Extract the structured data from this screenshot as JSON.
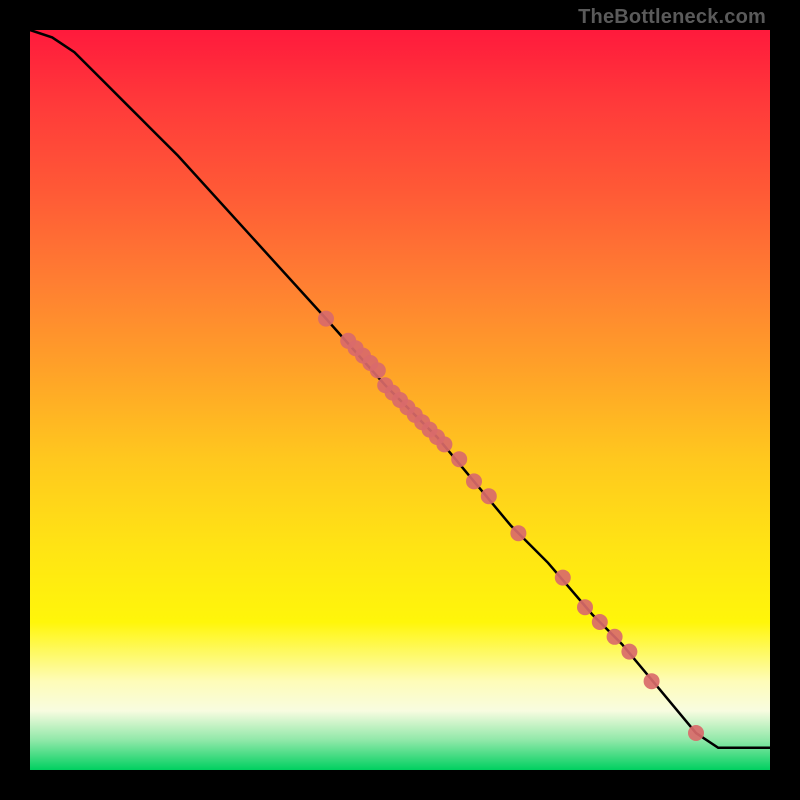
{
  "watermark": "TheBottleneck.com",
  "chart_data": {
    "type": "line",
    "title": "",
    "xlabel": "",
    "ylabel": "",
    "xlim": [
      0,
      100
    ],
    "ylim": [
      0,
      100
    ],
    "note": "No visible axis ticks or numeric labels in source image; values are approximate fractions of plot area read from pixel positions.",
    "series": [
      {
        "name": "curve",
        "x": [
          0,
          3,
          6,
          10,
          15,
          20,
          30,
          40,
          48,
          50,
          55,
          60,
          65,
          70,
          76,
          80,
          85,
          90,
          93,
          95,
          100
        ],
        "y": [
          100,
          99,
          97,
          93,
          88,
          83,
          72,
          61,
          52,
          50,
          45,
          39,
          33,
          28,
          21,
          17,
          11,
          5,
          3,
          3,
          3
        ]
      }
    ],
    "points": {
      "name": "markers",
      "x": [
        40,
        43,
        44,
        45,
        46,
        47,
        48,
        49,
        50,
        51,
        52,
        53,
        54,
        55,
        56,
        58,
        60,
        62,
        66,
        72,
        75,
        77,
        79,
        81,
        84,
        90
      ],
      "y": [
        61,
        58,
        57,
        56,
        55,
        54,
        52,
        51,
        50,
        49,
        48,
        47,
        46,
        45,
        44,
        42,
        39,
        37,
        32,
        26,
        22,
        20,
        18,
        16,
        12,
        5
      ]
    },
    "marker_color": "#d96a6a",
    "line_color": "#000000"
  }
}
